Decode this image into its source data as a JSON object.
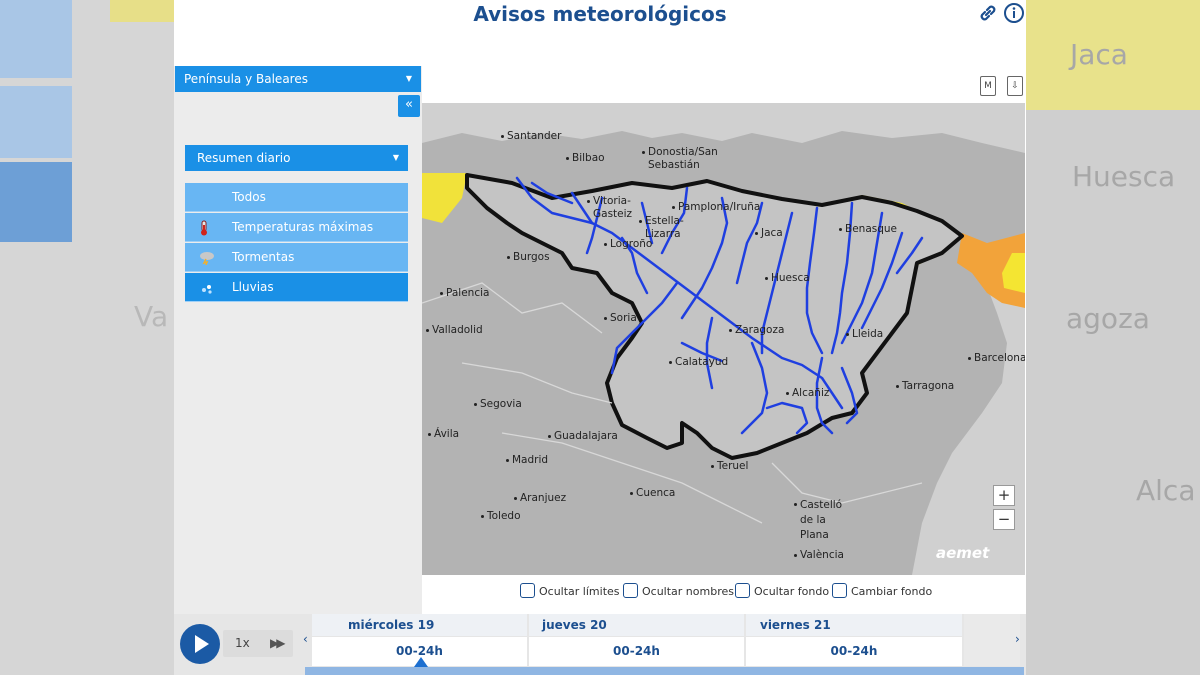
{
  "header": {
    "title": "Avisos meteorológicos",
    "link_icon": "link-icon",
    "info_icon": "info-icon"
  },
  "sidebar": {
    "region_select": "Península y Baleares",
    "collapse_label": "«",
    "summary_select": "Resumen diario",
    "layers": [
      {
        "label": "Todos",
        "icon": "",
        "active": false
      },
      {
        "label": "Temperaturas máximas",
        "icon": "thermometer-icon",
        "active": false
      },
      {
        "label": "Tormentas",
        "icon": "storm-icon",
        "active": false
      },
      {
        "label": "Lluvias",
        "icon": "rain-icon",
        "active": true
      }
    ]
  },
  "map": {
    "tool_m": "M",
    "tool_download": "⇩",
    "zoom_in": "+",
    "zoom_out": "−",
    "logo": "aemet",
    "colors": {
      "warning_yellow": "#f4e532",
      "warning_orange": "#f2a33a",
      "basin_outline": "#111111",
      "rivers": "#1f3fe0",
      "terrain": "#b2b2b2",
      "sea": "#cfcfcf"
    },
    "cities": [
      {
        "name": "Santander"
      },
      {
        "name": "Bilbao"
      },
      {
        "name": "Donostia/San Sebastián"
      },
      {
        "name": "Vitoria-Gasteiz"
      },
      {
        "name": "Estella-Lizarra"
      },
      {
        "name": "Pamplona/Iruña"
      },
      {
        "name": "Logroño"
      },
      {
        "name": "Jaca"
      },
      {
        "name": "Benasque"
      },
      {
        "name": "Burgos"
      },
      {
        "name": "Huesca"
      },
      {
        "name": "Palencia"
      },
      {
        "name": "Soria"
      },
      {
        "name": "Valladolid"
      },
      {
        "name": "Zaragoza"
      },
      {
        "name": "Lleida"
      },
      {
        "name": "Calatayud"
      },
      {
        "name": "Barcelona"
      },
      {
        "name": "Tarragona"
      },
      {
        "name": "Segovia"
      },
      {
        "name": "Alcañiz"
      },
      {
        "name": "Ávila"
      },
      {
        "name": "Guadalajara"
      },
      {
        "name": "Madrid"
      },
      {
        "name": "Teruel"
      },
      {
        "name": "Cuenca"
      },
      {
        "name": "Aranjuez"
      },
      {
        "name": "Toledo"
      },
      {
        "name": "Castelló de la Plana"
      },
      {
        "name": "València"
      }
    ]
  },
  "options": [
    {
      "label": "Ocultar límites"
    },
    {
      "label": "Ocultar nombres"
    },
    {
      "label": "Ocultar fondo"
    },
    {
      "label": "Cambiar fondo"
    }
  ],
  "timeline": {
    "speed": "1x",
    "days": [
      {
        "name": "miércoles 19",
        "slot": "00-24h",
        "selected": true
      },
      {
        "name": "jueves 20",
        "slot": "00-24h",
        "selected": false
      },
      {
        "name": "viernes 21",
        "slot": "00-24h",
        "selected": false
      }
    ],
    "prev": "‹",
    "next": "›"
  },
  "background": {
    "left_text": "Va",
    "right_texts": [
      "Jaca",
      "Huesca",
      "agoza",
      "Alca"
    ]
  }
}
